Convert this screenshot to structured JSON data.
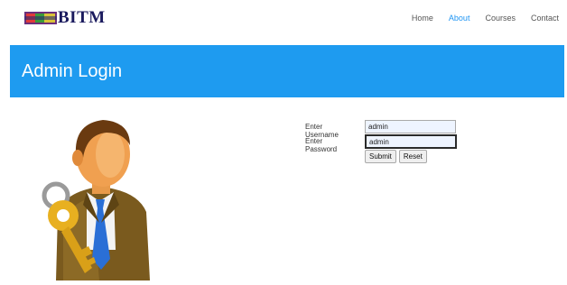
{
  "logo": {
    "text": "BITM"
  },
  "nav": {
    "items": [
      "Home",
      "About",
      "Courses",
      "Contact"
    ],
    "active_index": 1
  },
  "banner": {
    "title": "Admin Login"
  },
  "form": {
    "username_label": "Enter Username",
    "username_value": "admin",
    "password_label": "Enter Password",
    "password_value": "admin",
    "submit_label": "Submit",
    "reset_label": "Reset"
  },
  "colors": {
    "accent": "#1e9bf0",
    "nav_active": "#2196f3",
    "logo_text": "#1a1a5e"
  },
  "illustration": {
    "icon": "admin-user-with-key-icon"
  }
}
